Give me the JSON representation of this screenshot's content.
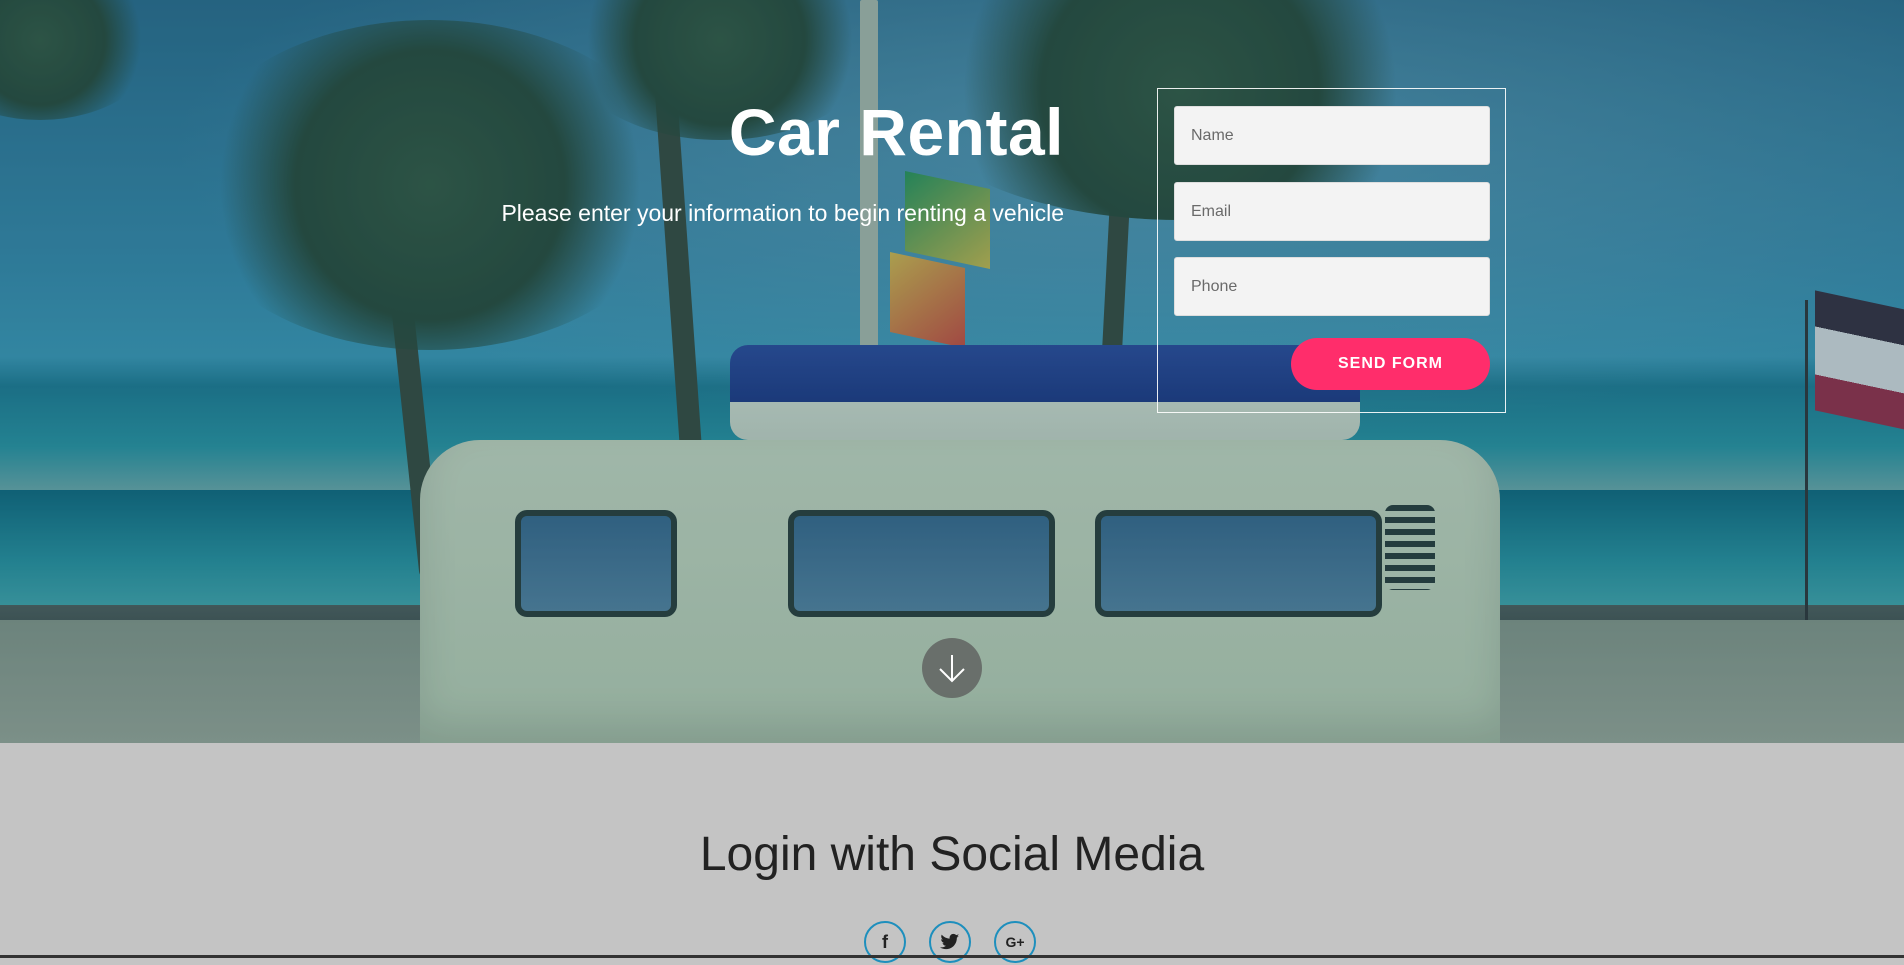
{
  "hero": {
    "title": "Car Rental",
    "subtitle": "Please enter your information to begin renting a vehicle"
  },
  "form": {
    "name_placeholder": "Name",
    "email_placeholder": "Email",
    "phone_placeholder": "Phone",
    "send_label": "SEND FORM",
    "accent_color": "#ff2d6b"
  },
  "scroll_button": {
    "icon": "arrow-down-icon"
  },
  "social": {
    "title": "Login with Social Media",
    "icons": [
      {
        "name": "facebook-icon",
        "glyph": "f"
      },
      {
        "name": "twitter-icon",
        "glyph": "🐦"
      },
      {
        "name": "google-plus-icon",
        "glyph": "G+"
      }
    ],
    "ring_color": "#1d8fbd"
  }
}
